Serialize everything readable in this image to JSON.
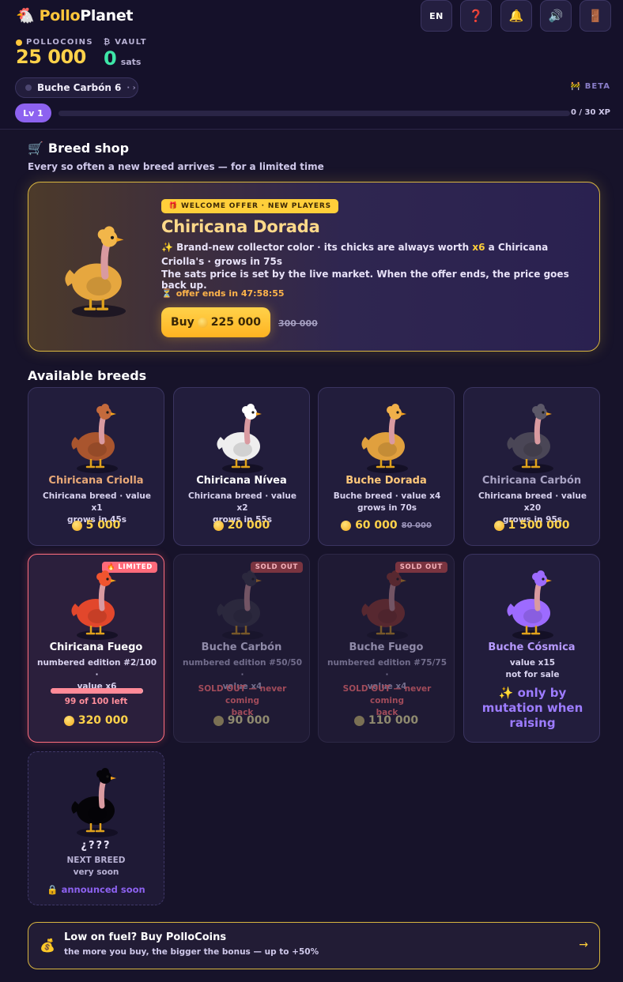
{
  "app": {
    "name_part1": "Pollo",
    "name_part2": "Planet",
    "logo_icon": "chicken-icon"
  },
  "header_buttons": {
    "language": "EN",
    "help_icon": "❓",
    "notifications_icon": "🔔",
    "sound_icon": "🔊",
    "exit_icon": "🚪"
  },
  "wallet": {
    "pollocoins_label": "POLLOCOINS",
    "pollocoins_value": "25 000",
    "vault_label": "₿ VAULT",
    "vault_value": "0",
    "vault_unit": "sats"
  },
  "plot_selector": {
    "label": "Buche Carbón 6",
    "more": "· ›"
  },
  "beta_label": "BETA",
  "level": {
    "label": "Lv 1",
    "xp_text": "0 / 30 XP",
    "xp_fraction": 0
  },
  "breed_shop": {
    "icon": "🛒",
    "title": "Breed shop",
    "subtitle": "Every so often a new breed arrives — for a limited time"
  },
  "offer": {
    "badge": "WELCOME OFFER · NEW PLAYERS",
    "badge_icon": "🎁",
    "name": "Chiricana Dorada",
    "desc_prefix": "✨ Brand-new collector color · its chicks are always worth ",
    "desc_highlight": "x6",
    "desc_suffix": " a Chiricana Criolla's · grows in 75s",
    "desc_line2": "The sats price is set by the live market. When the offer ends, the price goes back up.",
    "timer_icon": "⏳",
    "timer": "offer ends in 47:58:55",
    "buy_label": "Buy",
    "buy_price": "225 000",
    "old_price": "300 000",
    "colors": {
      "body": "#e6a73f",
      "comb": "#f2b64a"
    }
  },
  "available_title": "Available breeds",
  "breeds": [
    {
      "name": "Chiricana Criolla",
      "desc": "Chiricana breed · value x1\ngrows in 45s",
      "price": "5 000",
      "name_color": "#e8a877",
      "body": "#a9552e",
      "crest": "#c46a3c"
    },
    {
      "name": "Chiricana Nívea",
      "desc": "Chiricana breed · value x2\ngrows in 55s",
      "price": "20 000",
      "name_color": "#ffffff",
      "body": "#eeeeee",
      "crest": "#ffffff"
    },
    {
      "name": "Buche Dorada",
      "desc": "Buche breed · value x4\ngrows in 70s",
      "price": "60 000",
      "old_price": "80 000",
      "name_color": "#ffc87a",
      "body": "#e0a03e",
      "crest": "#f0b04a"
    },
    {
      "name": "Chiricana Carbón",
      "desc": "Chiricana breed · value x20\ngrows in 95s",
      "price": "1 500 000",
      "name_color": "#a9a3c4",
      "body": "#4a4656",
      "crest": "#5c5868"
    },
    {
      "name": "Chiricana Fuego",
      "tag": "LIMITED",
      "tag_icon": "🔥",
      "desc": "numbered edition #2/100 ·\nvalue x6",
      "left_text": "99 of 100 left",
      "left_fraction": 0.99,
      "price": "320 000",
      "name_color": "#ffffff",
      "body": "#e2472c",
      "crest": "#f0542f"
    },
    {
      "name": "Buche Carbón",
      "tag": "SOLD OUT",
      "desc": "numbered edition #50/50 ·\nvalue x4",
      "note": "SOLD OUT — never coming\nback",
      "price": "90 000",
      "body": "#3a3a4a",
      "crest": "#3a3a4a"
    },
    {
      "name": "Buche Fuego",
      "tag": "SOLD OUT",
      "desc": "numbered edition #75/75 ·\nvalue x4",
      "note": "SOLD OUT — never coming\nback",
      "price": "110 000",
      "body": "#9b3a2c",
      "crest": "#9b3a2c"
    },
    {
      "name": "Buche Cósmica",
      "desc": "value x15\nnot for sale",
      "mutation": "✨ only by mutation when raising",
      "name_color": "#b79aff",
      "body": "#9d6bff",
      "crest": "#9d6bff"
    }
  ],
  "mystery": {
    "title": "¿???",
    "line1": "NEXT BREED",
    "line2": "very soon",
    "lock_icon": "🔒",
    "announce": "announced soon"
  },
  "fuel_banner": {
    "icon": "💰",
    "title": "Low on fuel? Buy PolloCoins",
    "subtitle": "the more you buy, the bigger the bonus — up to +50%",
    "arrow": "→"
  }
}
